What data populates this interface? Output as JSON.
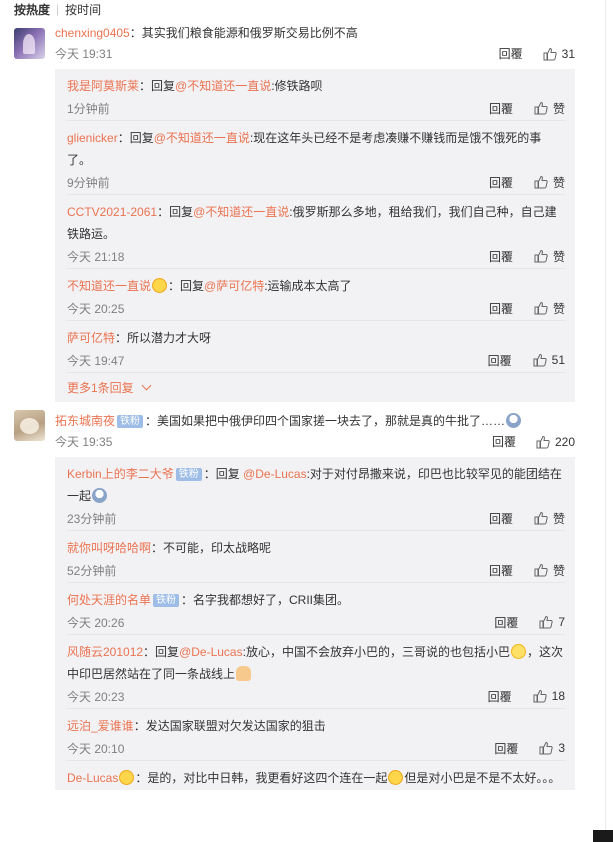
{
  "sort": {
    "hot": "按热度",
    "time": "按时间"
  },
  "reply_label": "回覆",
  "comments": [
    {
      "user": "chenxing0405",
      "text": "：其实我们粮食能源和俄罗斯交易比例不高",
      "time": "今天 19:31",
      "likes": "31",
      "replies": [
        {
          "user": "我是阿莫斯莱",
          "pre": "：回复",
          "at": "@不知道还一直说",
          "text": ":修铁路呗",
          "time": "1分钟前",
          "likes": "赞"
        },
        {
          "user": "glienicker",
          "pre": "：回复",
          "at": "@不知道还一直说",
          "text": ":现在这年头已经不是考虑凑赚不赚钱而是饿不饿死的事了。",
          "time": "9分钟前",
          "likes": "赞"
        },
        {
          "user": "CCTV2021-2061",
          "pre": "：回复",
          "at": "@不知道还一直说",
          "text": ":俄罗斯那么多地，租给我们，我们自己种，自己建铁路运。",
          "time": "今天 21:18",
          "likes": "赞"
        },
        {
          "user": "不知道还一直说",
          "pre": "：回复",
          "at": "@萨可亿特",
          "text": ":运输成本太高了",
          "time": "今天 20:25",
          "likes": "赞"
        },
        {
          "user": "萨可亿特",
          "pre": "",
          "at": "",
          "text": "：所以潜力才大呀",
          "time": "今天 19:47",
          "likes": "51"
        }
      ],
      "more": "更多1条回复"
    },
    {
      "user": "拓东城南夜",
      "badge": "铁粉",
      "text": "：美国如果把中俄伊印四个国家搓一块去了，那就是真的牛批了……",
      "time": "今天 19:35",
      "likes": "220",
      "replies": [
        {
          "user": "Kerbin上的李二大爷",
          "badge": "铁粉",
          "pre": "：回复 ",
          "at": "@De-Lucas",
          "text": ":对于对付昂撒来说，印巴也比较罕见的能团结在一起",
          "time": "23分钟前",
          "likes": "赞"
        },
        {
          "user": "就你叫呀哈哈啊",
          "pre": "",
          "at": "",
          "text": "：不可能，印太战略呢",
          "time": "52分钟前",
          "likes": "赞"
        },
        {
          "user": "何处天涯的名单",
          "badge": "铁粉",
          "pre": "",
          "at": "",
          "text": "：名字我都想好了，CRII集团。",
          "time": "今天 20:26",
          "likes": "7"
        },
        {
          "user": "风随云201012",
          "pre": "：回复",
          "at": "@De-Lucas",
          "text": ":放心，中国不会放弃小巴的，三哥说的也包括小巴",
          "text2": "，这次中印巴居然站在了同一条战线上",
          "time": "今天 20:23",
          "likes": "18"
        },
        {
          "user": "远泊_爱谁谁",
          "pre": "",
          "at": "",
          "text": "：发达国家联盟对欠发达国家的狙击",
          "time": "今天 20:10",
          "likes": "3"
        },
        {
          "user": "De-Lucas",
          "pre": "",
          "at": "",
          "text": "：是的，对比中日韩，我更看好这四个连在一起",
          "text2": "但是对小巴是不是不太好。。。",
          "time": "",
          "likes": ""
        }
      ]
    }
  ]
}
